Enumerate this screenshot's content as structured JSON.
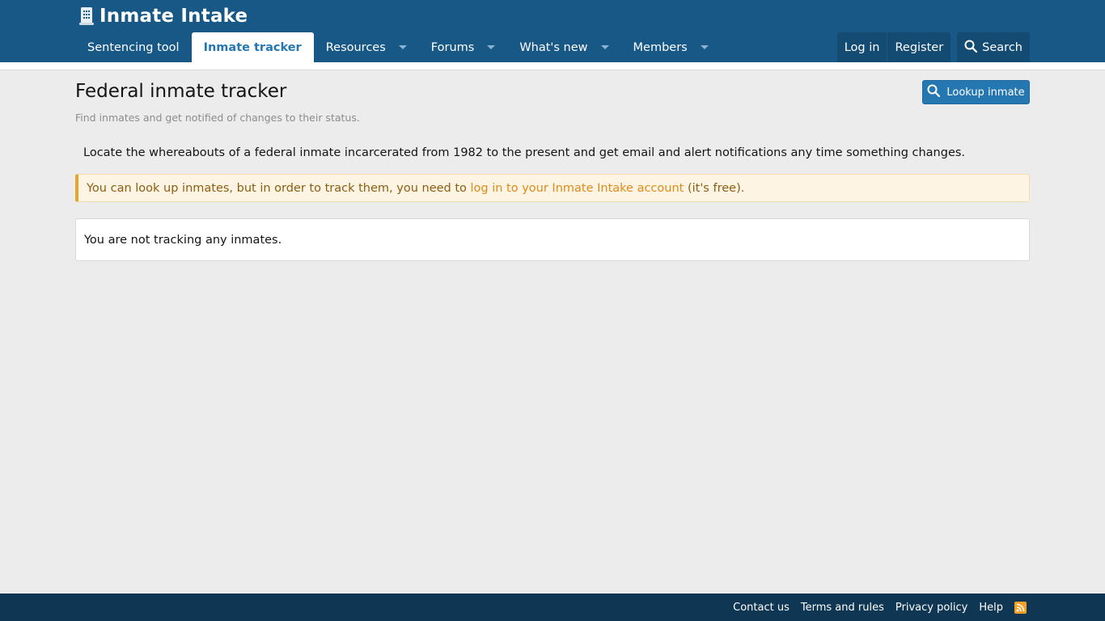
{
  "header": {
    "site_name": "Inmate Intake",
    "logo_icon": "building-icon"
  },
  "nav": {
    "tabs": [
      {
        "label": "Sentencing tool",
        "has_dropdown": false
      },
      {
        "label": "Inmate tracker",
        "selected": true,
        "has_dropdown": false
      },
      {
        "label": "Resources",
        "has_dropdown": true
      },
      {
        "label": "Forums",
        "has_dropdown": true
      },
      {
        "label": "What's new",
        "has_dropdown": true
      },
      {
        "label": "Members",
        "has_dropdown": true
      }
    ],
    "login": "Log in",
    "register": "Register",
    "search": "Search"
  },
  "page": {
    "title": "Federal inmate tracker",
    "description": "Find inmates and get notified of changes to their status.",
    "lookup_button": "Lookup inmate",
    "intro": "Locate the whereabouts of a federal inmate incarcerated from 1982 to the present and get email and alert notifications any time something changes.",
    "notice_before": "You can look up inmates, but in order to track them, you need to ",
    "notice_link": "log in to your Inmate Intake account",
    "notice_after": " (it's free).",
    "empty_message": "You are not tracking any inmates."
  },
  "footer": {
    "links": [
      "Contact us",
      "Terms and rules",
      "Privacy policy",
      "Help"
    ]
  },
  "colors": {
    "header_bg": "#185886",
    "accent": "#2577b1",
    "footer_bg": "#0f3652",
    "notice_border": "#e5a334",
    "rss": "#f8a023"
  }
}
